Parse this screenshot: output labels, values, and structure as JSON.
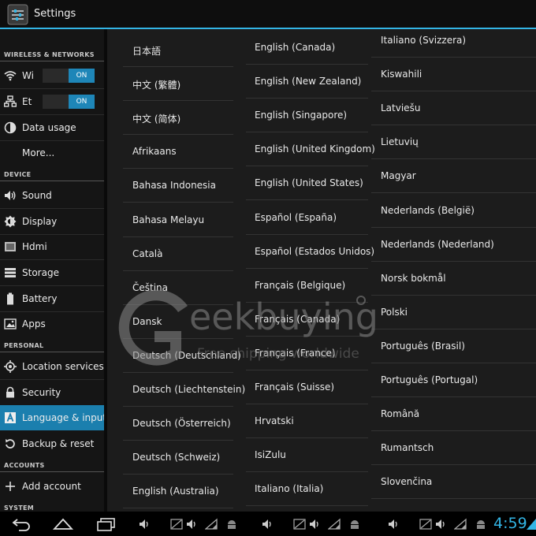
{
  "window": {
    "title": "Settings",
    "app_icon": "settings-icon"
  },
  "sidebar": {
    "headers": [
      "WIRELESS & NETWORKS",
      "DEVICE",
      "PERSONAL",
      "ACCOUNTS",
      "SYSTEM"
    ],
    "items": [
      {
        "label": "Wi",
        "icon": "wifi-icon",
        "toggle": "ON"
      },
      {
        "label": "Et",
        "icon": "ethernet-icon",
        "toggle": "ON"
      },
      {
        "label": "Data usage",
        "icon": "data-usage-icon"
      },
      {
        "label": "More...",
        "icon": ""
      },
      {
        "label": "Sound",
        "icon": "volume-icon"
      },
      {
        "label": "Display",
        "icon": "brightness-icon"
      },
      {
        "label": "Hdmi",
        "icon": "hdmi-icon"
      },
      {
        "label": "Storage",
        "icon": "storage-icon"
      },
      {
        "label": "Battery",
        "icon": "battery-icon"
      },
      {
        "label": "Apps",
        "icon": "apps-icon"
      },
      {
        "label": "Location services",
        "icon": "location-icon"
      },
      {
        "label": "Security",
        "icon": "lock-icon"
      },
      {
        "label": "Language & input",
        "icon": "keyboard-icon",
        "selected": true
      },
      {
        "label": "Backup & reset",
        "icon": "backup-icon"
      },
      {
        "label": "Add account",
        "icon": "plus-icon"
      }
    ]
  },
  "languages": {
    "column1": [
      "日本語",
      "中文 (繁體)",
      "中文 (简体)",
      "Afrikaans",
      "Bahasa Indonesia",
      "Bahasa Melayu",
      "Català",
      "Čeština",
      "Dansk",
      "Deutsch (Deutschland)",
      "Deutsch (Liechtenstein)",
      "Deutsch (Österreich)",
      "Deutsch (Schweiz)",
      "English (Australia)"
    ],
    "column2": [
      "English (Canada)",
      "English (New Zealand)",
      "English (Singapore)",
      "English (United Kingdom)",
      "English (United States)",
      "Español (España)",
      "Español (Estados Unidos)",
      "Français (Belgique)",
      "Français (Canada)",
      "Français (France)",
      "Français (Suisse)",
      "Hrvatski",
      "IsiZulu",
      "Italiano (Italia)"
    ],
    "column3": [
      "Italiano (Svizzera)",
      "Kiswahili",
      "Latviešu",
      "Lietuvių",
      "Magyar",
      "Nederlands (België)",
      "Nederlands (Nederland)",
      "Norsk bokmål",
      "Polski",
      "Português (Brasil)",
      "Português (Portugal)",
      "Română",
      "Rumantsch",
      "Slovenčina"
    ]
  },
  "watermark": {
    "brand": "eekbuying",
    "tagline": "Free shipping worldwide"
  },
  "status_bar": {
    "clock": "4:59",
    "nav_icons": [
      "back-icon",
      "home-icon",
      "recent-apps-icon"
    ],
    "notification_icons": [
      "volume-icon",
      "screenshot-icon",
      "volume-icon",
      "signal-icon",
      "android-icon",
      "volume-icon",
      "screenshot-icon",
      "volume-icon",
      "signal-icon",
      "android-icon",
      "volume-icon",
      "screenshot-icon",
      "volume-icon",
      "signal-icon",
      "android-icon",
      "wifi-icon"
    ],
    "accent": "#33b5e5"
  }
}
